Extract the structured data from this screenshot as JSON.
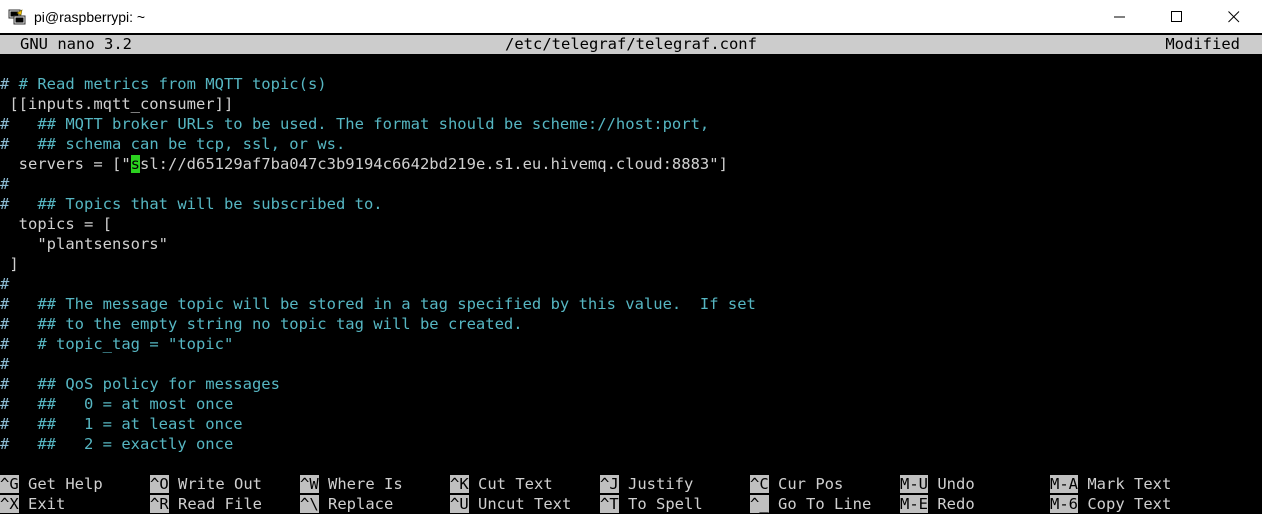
{
  "window": {
    "title": "pi@raspberrypi: ~"
  },
  "nano": {
    "version": "GNU nano 3.2",
    "filename": "/etc/telegraf/telegraf.conf",
    "status": "Modified"
  },
  "editor": {
    "lines": [
      {
        "hash": "# ",
        "text": "# Read metrics from MQTT topic(s)",
        "kind": "comment"
      },
      {
        "hash": "",
        "text": " [[inputs.mqtt_consumer]]",
        "kind": "code"
      },
      {
        "hash": "#",
        "text": "   ## MQTT broker URLs to be used. The format should be scheme://host:port,",
        "kind": "comment"
      },
      {
        "hash": "#",
        "text": "   ## schema can be tcp, ssl, or ws.",
        "kind": "comment"
      },
      {
        "hash": "",
        "text": "  servers = [\"",
        "kind": "code",
        "cursor": "s",
        "after": "sl://d65129af7ba047c3b9194c6642bd219e.s1.eu.hivemq.cloud:8883\"]"
      },
      {
        "hash": "#",
        "text": "",
        "kind": "comment"
      },
      {
        "hash": "#",
        "text": "   ## Topics that will be subscribed to.",
        "kind": "comment"
      },
      {
        "hash": "",
        "text": "  topics = [",
        "kind": "code"
      },
      {
        "hash": "",
        "text": "    \"plantsensors\"",
        "kind": "code"
      },
      {
        "hash": "",
        "text": " ]",
        "kind": "code"
      },
      {
        "hash": "#",
        "text": "",
        "kind": "comment"
      },
      {
        "hash": "#",
        "text": "   ## The message topic will be stored in a tag specified by this value.  If set",
        "kind": "comment"
      },
      {
        "hash": "#",
        "text": "   ## to the empty string no topic tag will be created.",
        "kind": "comment"
      },
      {
        "hash": "#",
        "text": "   # topic_tag = \"topic\"",
        "kind": "comment"
      },
      {
        "hash": "#",
        "text": "",
        "kind": "comment"
      },
      {
        "hash": "#",
        "text": "   ## QoS policy for messages",
        "kind": "comment"
      },
      {
        "hash": "#",
        "text": "   ##   0 = at most once",
        "kind": "comment"
      },
      {
        "hash": "#",
        "text": "   ##   1 = at least once",
        "kind": "comment"
      },
      {
        "hash": "#",
        "text": "   ##   2 = exactly once",
        "kind": "comment"
      }
    ]
  },
  "shortcuts": {
    "row1": [
      {
        "key": "^G",
        "label": " Get Help"
      },
      {
        "key": "^O",
        "label": " Write Out"
      },
      {
        "key": "^W",
        "label": " Where Is"
      },
      {
        "key": "^K",
        "label": " Cut Text"
      },
      {
        "key": "^J",
        "label": " Justify"
      },
      {
        "key": "^C",
        "label": " Cur Pos"
      },
      {
        "key": "M-U",
        "label": " Undo"
      },
      {
        "key": "M-A",
        "label": " Mark Text"
      }
    ],
    "row2": [
      {
        "key": "^X",
        "label": " Exit"
      },
      {
        "key": "^R",
        "label": " Read File"
      },
      {
        "key": "^\\",
        "label": " Replace"
      },
      {
        "key": "^U",
        "label": " Uncut Text"
      },
      {
        "key": "^T",
        "label": " To Spell"
      },
      {
        "key": "^_",
        "label": " Go To Line"
      },
      {
        "key": "M-E",
        "label": " Redo"
      },
      {
        "key": "M-6",
        "label": " Copy Text"
      }
    ]
  }
}
